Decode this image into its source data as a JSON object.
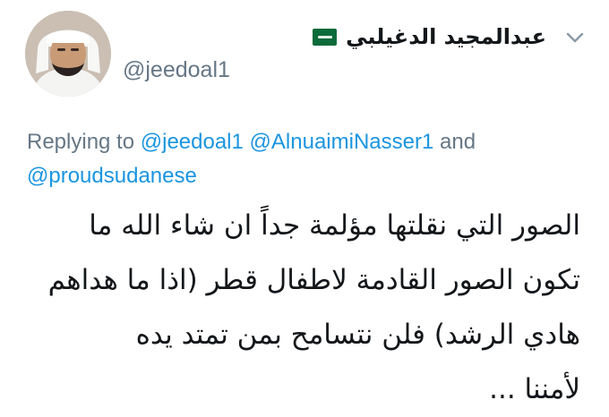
{
  "tweet": {
    "author": {
      "display_name": "عبدالمجيد الدغيلبي",
      "handle": "@jeedoal1",
      "flag_icon": "saudi-arabia-flag-icon",
      "flag_color": "#0b6b3a"
    },
    "reply": {
      "prefix": "Replying to",
      "mention_1": "@jeedoal1",
      "mention_2": "@AlnuaimiNasser1",
      "conjunction": "and",
      "mention_3": "@proudsudanese",
      "mention_color": "#1b95e0"
    },
    "text_lines": [
      "الصور التي نقلتها مؤلمة جداً ان شاء الله ما",
      "تكون الصور القادمة لاطفال قطر (اذا ما هداهم",
      "هادي الرشد) فلن نتسامح بمن تمتد يده",
      "لأمننا ..."
    ],
    "menu_icon": "chevron-down-icon"
  }
}
